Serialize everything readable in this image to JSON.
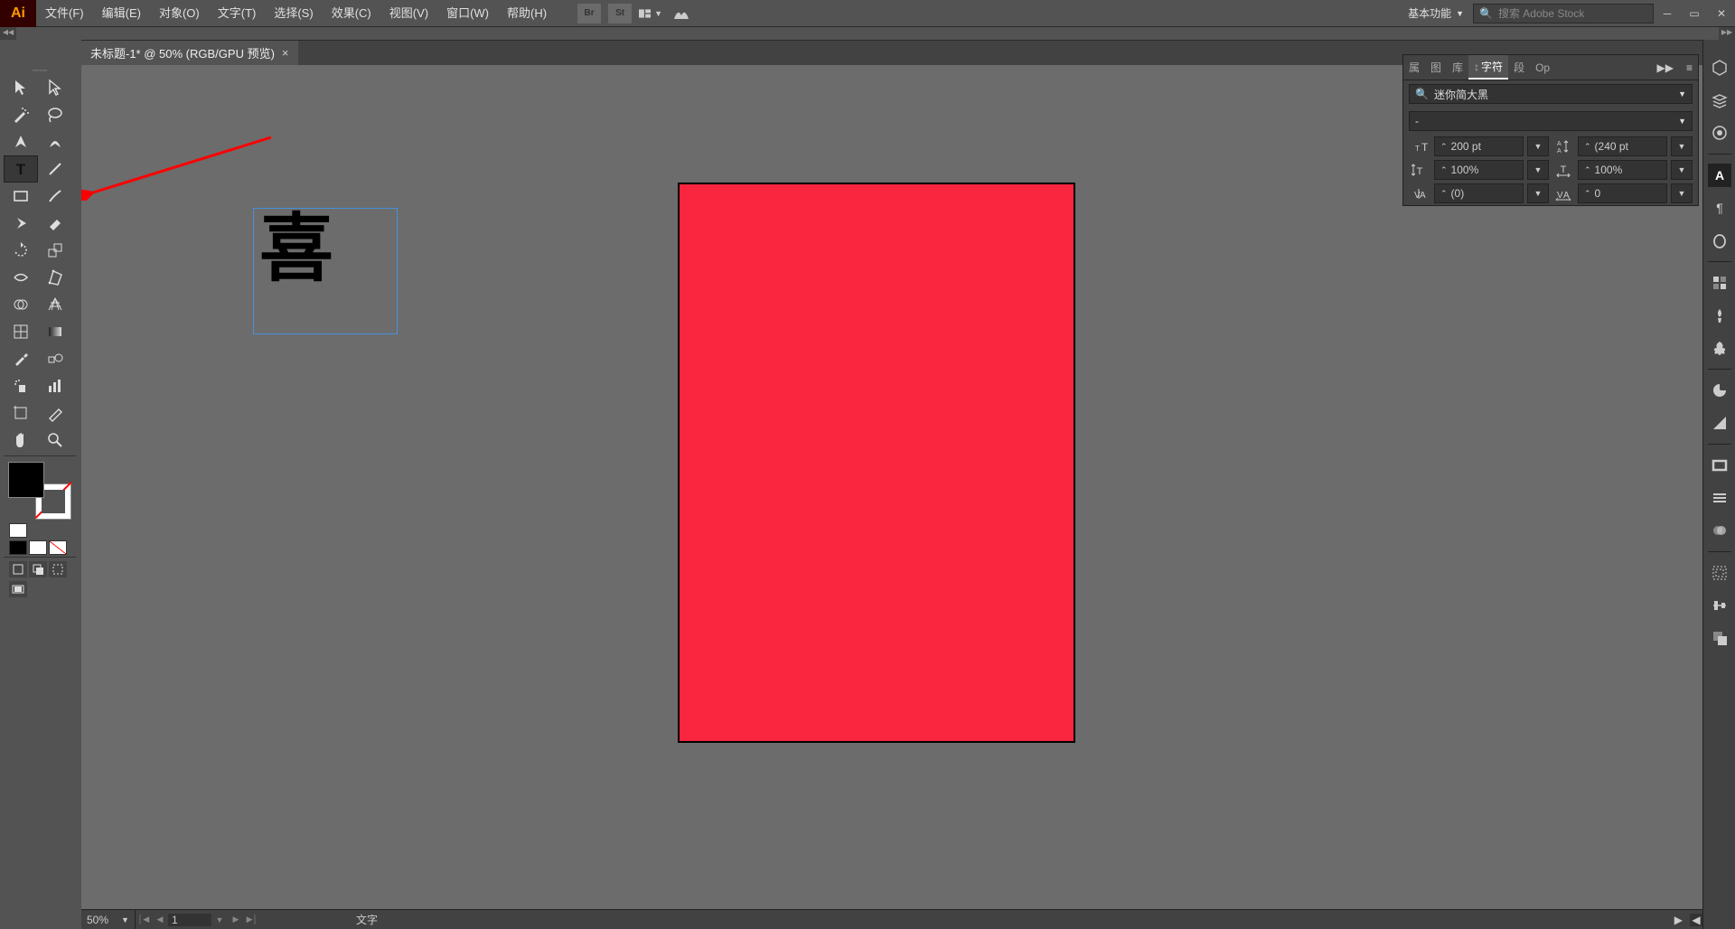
{
  "app": {
    "logo": "Ai"
  },
  "menu": {
    "file": "文件(F)",
    "edit": "编辑(E)",
    "object": "对象(O)",
    "type": "文字(T)",
    "select": "选择(S)",
    "effect": "效果(C)",
    "view": "视图(V)",
    "window": "窗口(W)",
    "help": "帮助(H)"
  },
  "top_icons": {
    "br": "Br",
    "st": "St"
  },
  "workspace": {
    "label": "基本功能"
  },
  "search": {
    "placeholder": "搜索 Adobe Stock"
  },
  "document": {
    "tab_title": "未标题-1* @ 50% (RGB/GPU 预览)",
    "text_content": "喜"
  },
  "status": {
    "zoom": "50%",
    "page": "1",
    "tool_label": "文字"
  },
  "char_panel": {
    "tabs": {
      "prop": "属",
      "lib": "图",
      "lib2": "库",
      "char": "字符",
      "seg": "段",
      "op": "Op"
    },
    "font_family": "迷你简大黑",
    "font_style": "-",
    "size": "200 pt",
    "leading": "(240 pt",
    "vscale": "100%",
    "hscale": "100%",
    "tracking": "(0)",
    "kern": "0"
  },
  "colors": {
    "artboard_fill": "#fa253f",
    "text_sel_border": "#4a90d9"
  }
}
